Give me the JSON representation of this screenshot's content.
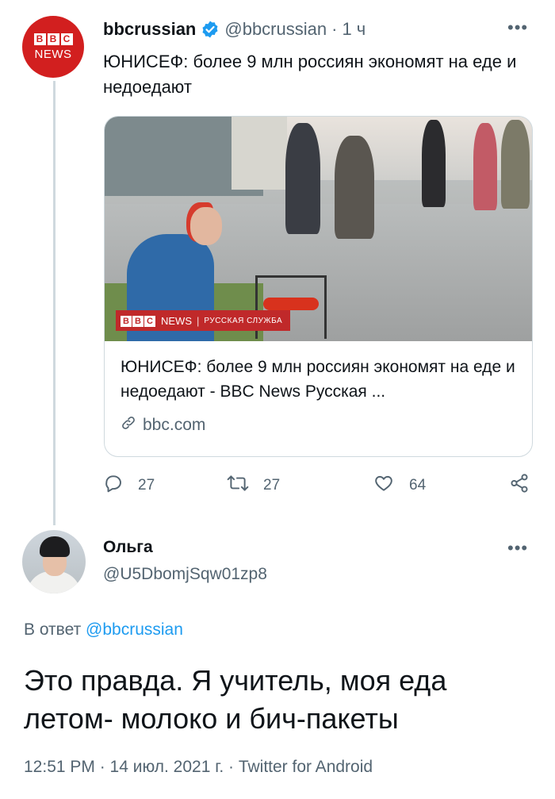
{
  "tweet": {
    "avatar": {
      "logo_boxes": [
        "B",
        "B",
        "C"
      ],
      "logo_word": "NEWS"
    },
    "author_name": "bbcrussian",
    "handle": "@bbcrussian",
    "separator": "·",
    "time": "1 ч",
    "more": "•••",
    "text": "ЮНИСЕФ: более 9 млн россиян экономят на еде и недоедают",
    "card": {
      "image_banner": {
        "boxes": [
          "B",
          "B",
          "C"
        ],
        "news": "NEWS",
        "divider": "|",
        "service": "РУССКАЯ СЛУЖБА"
      },
      "title": "ЮНИСЕФ: более 9 млн россиян экономят на еде и недоедают - BBC News Русская ...",
      "domain": "bbc.com"
    },
    "actions": {
      "replies": "27",
      "retweets": "27",
      "likes": "64"
    }
  },
  "reply": {
    "author_name": "Ольга",
    "handle": "@U5DbomjSqw01zp8",
    "more": "•••",
    "reply_prefix": "В ответ",
    "reply_mention": "@bbcrussian",
    "text": "Это правда. Я учитель, моя еда летом- молоко и бич-пакеты",
    "meta": "12:51 PM · 14 июл. 2021 г. · Twitter for Android"
  },
  "colors": {
    "accent": "#1d9bf0",
    "bbc_red": "#d21f1f",
    "secondary_text": "#536471"
  }
}
